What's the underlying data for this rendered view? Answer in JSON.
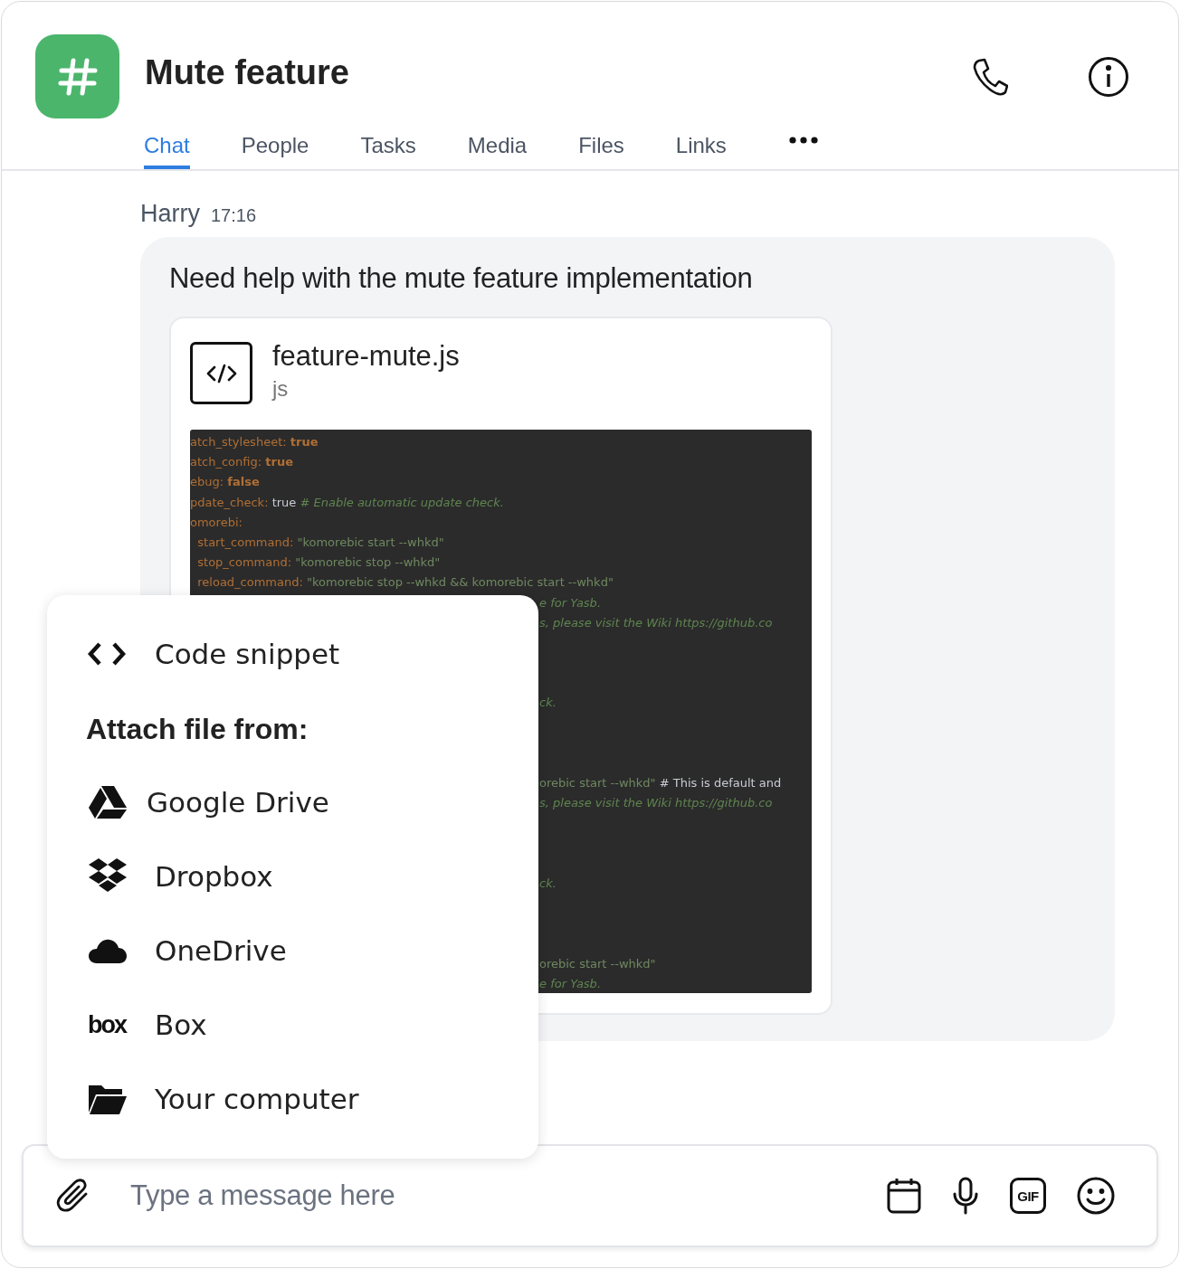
{
  "channel": {
    "title": "Mute feature"
  },
  "tabs": [
    {
      "label": "Chat",
      "selected": true
    },
    {
      "label": "People",
      "selected": false
    },
    {
      "label": "Tasks",
      "selected": false
    },
    {
      "label": "Media",
      "selected": false
    },
    {
      "label": "Files",
      "selected": false
    },
    {
      "label": "Links",
      "selected": false
    }
  ],
  "message": {
    "author": "Harry",
    "time": "17:16",
    "text": "Need help with the mute feature implementation",
    "attachment": {
      "filename": "feature-mute.js",
      "type": "js",
      "code_lines": [
        {
          "kind": "full",
          "segments": [
            {
              "kind": "key",
              "text": "atch_stylesheet: "
            },
            {
              "kind": "keyword",
              "text": "true"
            }
          ]
        },
        {
          "kind": "full",
          "segments": [
            {
              "kind": "key",
              "text": "atch_config: "
            },
            {
              "kind": "keyword",
              "text": "true"
            }
          ]
        },
        {
          "kind": "full",
          "segments": [
            {
              "kind": "key",
              "text": "ebug: "
            },
            {
              "kind": "keyword",
              "text": "false"
            }
          ]
        },
        {
          "kind": "full",
          "segments": [
            {
              "kind": "key",
              "text": "pdate_check: "
            },
            {
              "kind": "plain",
              "text": "true "
            },
            {
              "kind": "comment",
              "text": "# Enable automatic update check."
            }
          ]
        },
        {
          "kind": "full",
          "segments": [
            {
              "kind": "key",
              "text": "omorebi:"
            }
          ]
        },
        {
          "kind": "full",
          "segments": [
            {
              "kind": "key",
              "text": "  start_command: "
            },
            {
              "kind": "string",
              "text": "\"komorebic start --whkd\""
            }
          ]
        },
        {
          "kind": "full",
          "segments": [
            {
              "kind": "key",
              "text": "  stop_command: "
            },
            {
              "kind": "string",
              "text": "\"komorebic stop --whkd\""
            }
          ]
        },
        {
          "kind": "full",
          "segments": [
            {
              "kind": "key",
              "text": "  reload_command: "
            },
            {
              "kind": "string",
              "text": "\"komorebic stop --whkd && komorebic start --whkd\""
            }
          ]
        },
        {
          "kind": "tail",
          "segments": [
            {
              "kind": "comment",
              "text": "e for Yasb."
            }
          ]
        },
        {
          "kind": "tail",
          "segments": [
            {
              "kind": "comment",
              "text": "s, please visit the Wiki https://github.co"
            }
          ]
        },
        {
          "kind": "blank"
        },
        {
          "kind": "blank"
        },
        {
          "kind": "blank"
        },
        {
          "kind": "tail",
          "segments": [
            {
              "kind": "comment",
              "text": "ck."
            }
          ]
        },
        {
          "kind": "blank"
        },
        {
          "kind": "blank"
        },
        {
          "kind": "blank"
        },
        {
          "kind": "tail",
          "segments": [
            {
              "kind": "string",
              "text": "orebic start --whkd\" "
            },
            {
              "kind": "plain",
              "text": "# This is default and"
            }
          ]
        },
        {
          "kind": "tail",
          "segments": [
            {
              "kind": "comment",
              "text": "s, please visit the Wiki https://github.co"
            }
          ]
        },
        {
          "kind": "blank"
        },
        {
          "kind": "blank"
        },
        {
          "kind": "blank"
        },
        {
          "kind": "tail",
          "segments": [
            {
              "kind": "comment",
              "text": "ck."
            }
          ]
        },
        {
          "kind": "blank"
        },
        {
          "kind": "blank"
        },
        {
          "kind": "blank"
        },
        {
          "kind": "tail",
          "segments": [
            {
              "kind": "string",
              "text": "orebic start --whkd\""
            }
          ]
        },
        {
          "kind": "tail",
          "segments": [
            {
              "kind": "comment",
              "text": "e for Yasb."
            }
          ]
        }
      ]
    }
  },
  "attach_menu": {
    "items": [
      {
        "kind": "action",
        "label": "Code snippet"
      },
      {
        "kind": "heading",
        "label": "Attach file from:"
      },
      {
        "kind": "source",
        "label": "Google Drive"
      },
      {
        "kind": "source",
        "label": "Dropbox"
      },
      {
        "kind": "source",
        "label": "OneDrive"
      },
      {
        "kind": "source",
        "label": "Box",
        "logo": "box"
      },
      {
        "kind": "source",
        "label": "Your computer"
      }
    ]
  },
  "composer": {
    "placeholder": "Type a message here",
    "gif_label": "GIF"
  }
}
